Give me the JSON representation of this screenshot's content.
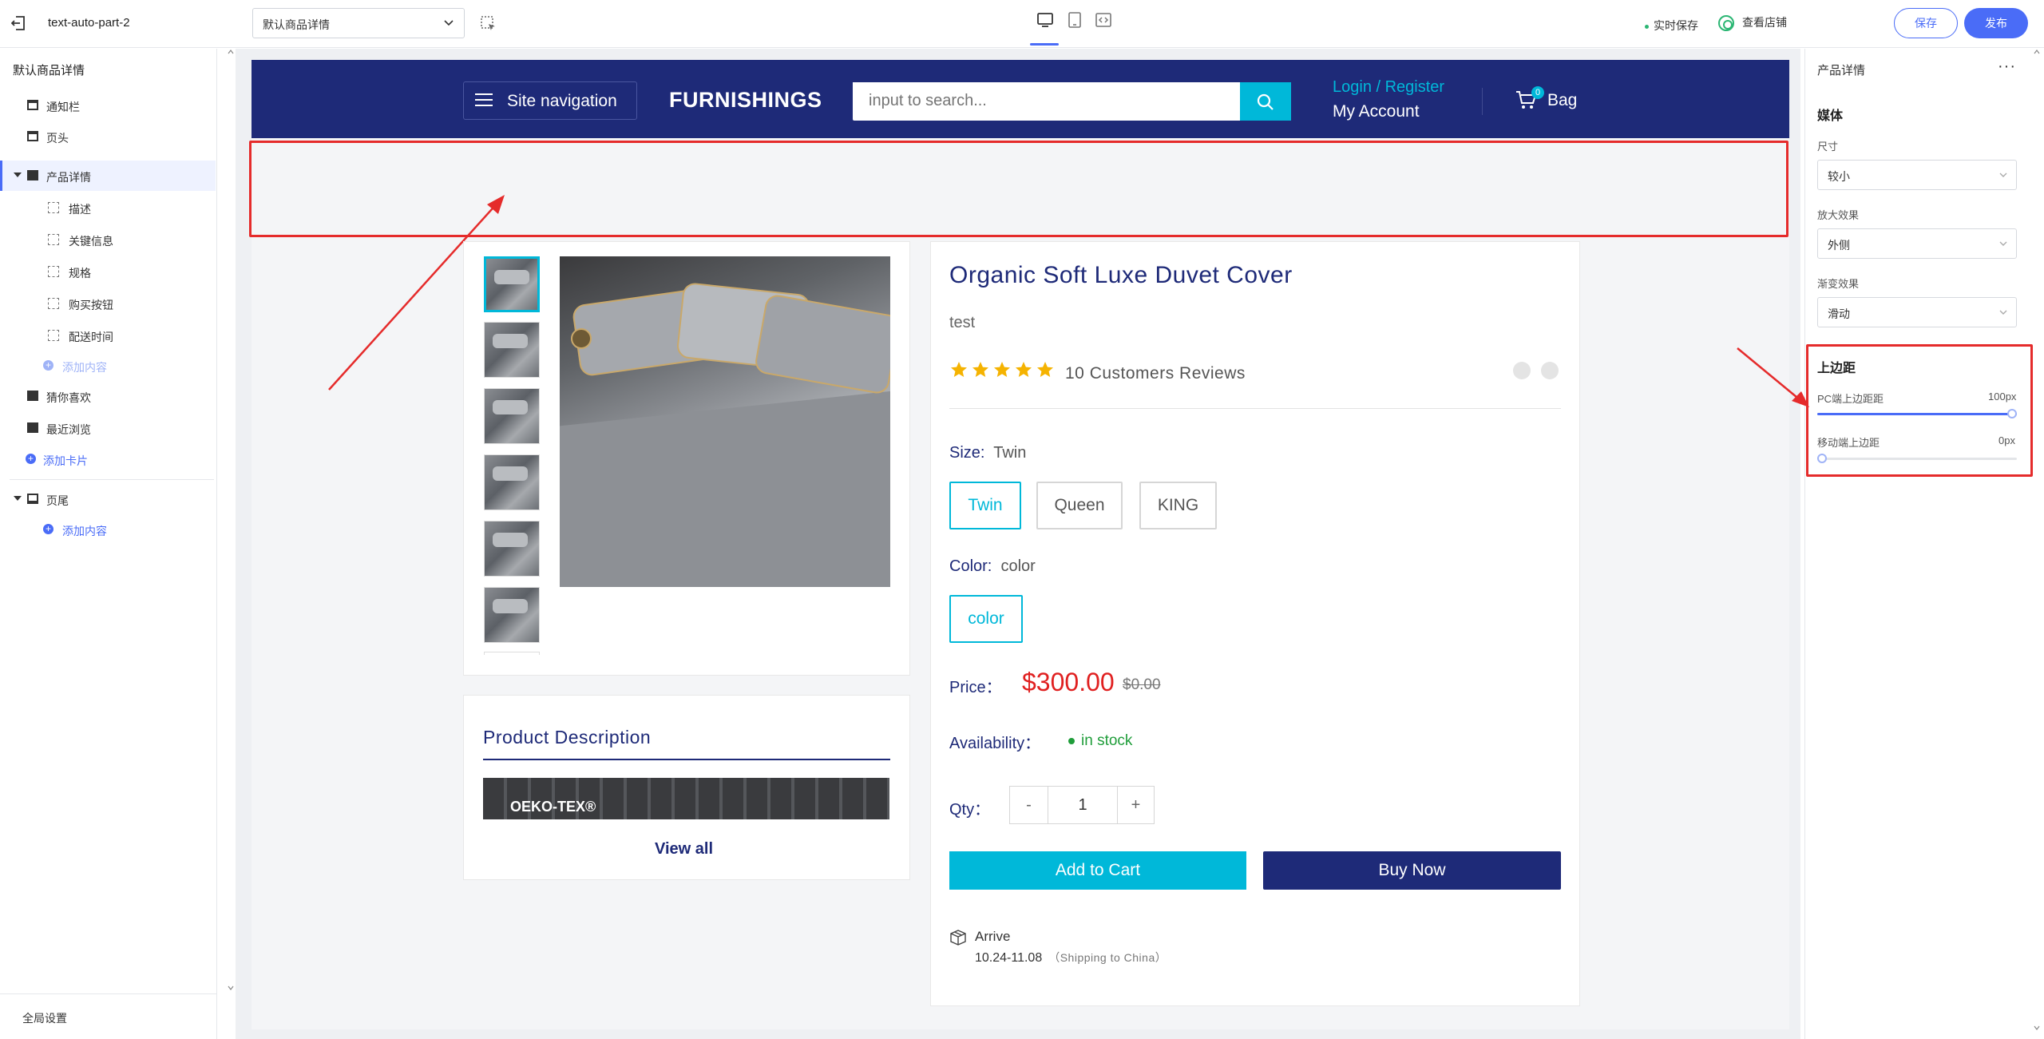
{
  "topbar": {
    "app_title": "text-auto-part-2",
    "page_select_value": "默认商品详情",
    "autosave_label": "实时保存",
    "view_store_label": "查看店铺",
    "save_label": "保存",
    "publish_label": "发布"
  },
  "left_panel": {
    "heading": "默认商品详情",
    "items": [
      {
        "label": "通知栏"
      },
      {
        "label": "页头"
      },
      {
        "label": "产品详情"
      },
      {
        "label": "描述"
      },
      {
        "label": "关键信息"
      },
      {
        "label": "规格"
      },
      {
        "label": "购买按钮"
      },
      {
        "label": "配送时间"
      },
      {
        "label": "添加内容"
      },
      {
        "label": "猜你喜欢"
      },
      {
        "label": "最近浏览"
      },
      {
        "label": "添加卡片"
      },
      {
        "label": "页尾"
      },
      {
        "label": "添加内容"
      }
    ],
    "global_settings": "全局设置"
  },
  "store": {
    "site_nav_label": "Site navigation",
    "brand": "FURNISHINGS",
    "search_placeholder": "input to search...",
    "login_label": "Login / Register",
    "account_label": "My Account",
    "bag_count": "0",
    "bag_label": "Bag"
  },
  "product": {
    "title": "Organic Soft Luxe Duvet Cover",
    "subtitle": "test",
    "rating": 5,
    "reviews": "10 Customers Reviews",
    "size_label": "Size:",
    "size_value": "Twin",
    "sizes": [
      "Twin",
      "Queen",
      "KING"
    ],
    "color_label": "Color:",
    "color_value": "color",
    "colors": [
      "color"
    ],
    "price_label": "Price：",
    "price": "$300.00",
    "compare_price": "$0.00",
    "availability_label": "Availability：",
    "availability": "in stock",
    "qty_label": "Qty：",
    "qty_minus": "-",
    "qty_value": "1",
    "qty_plus": "+",
    "add_to_cart": "Add to Cart",
    "buy_now": "Buy Now",
    "arrive_label": "Arrive",
    "arrive_dates": "10.24-11.08",
    "arrive_note": "（Shipping to China）"
  },
  "description": {
    "title": "Product Description",
    "image_text": "OEKO-TEX®",
    "view_all": "View all"
  },
  "right_panel": {
    "title": "产品详情",
    "more": "···",
    "media_heading": "媒体",
    "size_label": "尺寸",
    "size_value": "较小",
    "zoom_label": "放大效果",
    "zoom_value": "外侧",
    "gradient_label": "渐变效果",
    "gradient_value": "滑动",
    "margin_heading": "上边距",
    "pc_margin_label": "PC端上边距距",
    "pc_margin_value": "100px",
    "mobile_margin_label": "移动端上边距",
    "mobile_margin_value": "0px",
    "pc_margin_fraction": 1.0,
    "mobile_margin_fraction": 0.0
  },
  "colors": {
    "accent": "#4a6cf7",
    "navy": "#1e2a78",
    "cyan": "#00b8d9",
    "price_red": "#e02020",
    "star": "#f5b301",
    "annotation_red": "#e52b2b"
  }
}
